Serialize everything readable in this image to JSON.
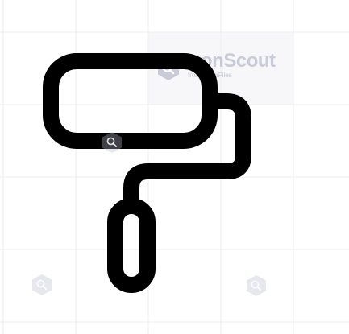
{
  "icon": {
    "name": "paint-roller-icon",
    "stroke_color": "#000000",
    "background_color": "#ffffff"
  },
  "watermark": {
    "brand": "IconScout",
    "sub": "from LottieFiles",
    "badge_icon": "search-icon",
    "color": "#b8bccd"
  }
}
